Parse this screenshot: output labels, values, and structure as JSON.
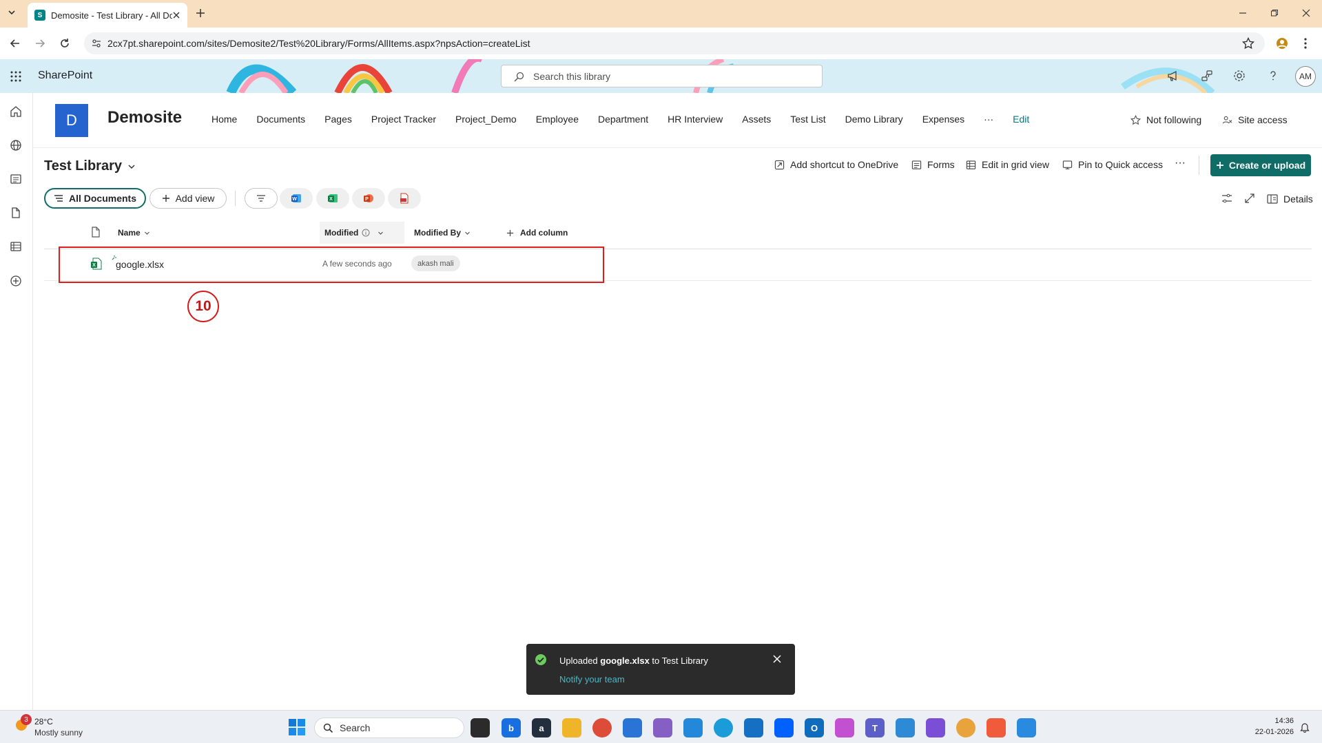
{
  "browser": {
    "tab_title": "Demosite - Test Library - All Do",
    "tab_favicon_letter": "S",
    "url": "2cx7pt.sharepoint.com/sites/Demosite2/Test%20Library/Forms/AllItems.aspx?npsAction=createList"
  },
  "suite": {
    "app_name": "SharePoint",
    "search_placeholder": "Search this library",
    "avatar_initials": "AM"
  },
  "site": {
    "logo_letter": "D",
    "title": "Demosite",
    "nav": [
      "Home",
      "Documents",
      "Pages",
      "Project Tracker",
      "Project_Demo",
      "Employee",
      "Department",
      "HR Interview",
      "Assets",
      "Test List",
      "Demo Library",
      "Expenses"
    ],
    "nav_more": "···",
    "nav_edit": "Edit",
    "follow_label": "Not following",
    "site_access_label": "Site access"
  },
  "library": {
    "title": "Test Library",
    "commands": {
      "shortcut": "Add shortcut to OneDrive",
      "forms": "Forms",
      "grid": "Edit in grid view",
      "pin": "Pin to Quick access",
      "more": "···",
      "create": "Create or upload"
    },
    "view": "All Documents",
    "add_view": "Add view",
    "details": "Details",
    "columns": {
      "name": "Name",
      "modified": "Modified",
      "modified_by": "Modified By",
      "add_column": "Add column"
    },
    "files": [
      {
        "name": "google.xlsx",
        "modified": "A few seconds ago",
        "modified_by": "akash mali"
      }
    ]
  },
  "annotation": {
    "step": "10"
  },
  "toast": {
    "prefix": "Uploaded ",
    "file": "google.xlsx",
    "suffix": " to Test Library",
    "link": "Notify your team"
  },
  "taskbar": {
    "weather_temp": "28°C",
    "weather_desc": "Mostly sunny",
    "weather_badge": "3",
    "search": "Search",
    "time": "14:36",
    "date": "22-01-2026"
  },
  "colors": {
    "accent": "#0f6c67",
    "annotation_red": "#e01c1c",
    "site_logo": "#2564cf"
  }
}
